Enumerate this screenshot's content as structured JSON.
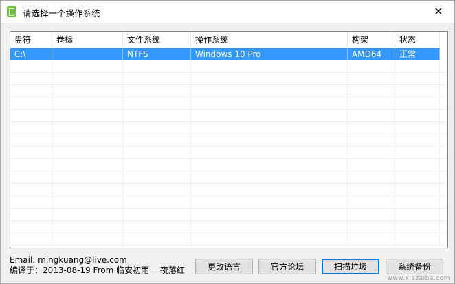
{
  "window": {
    "title": "请选择一个操作系统",
    "close_glyph": "✕"
  },
  "table": {
    "headers": [
      "盘符",
      "卷标",
      "文件系统",
      "操作系统",
      "构架",
      "状态"
    ],
    "rows": [
      [
        "C:\\",
        "",
        "NTFS",
        "Windows 10 Pro",
        "AMD64",
        "正常"
      ]
    ]
  },
  "footer": {
    "email_line": "Email:  mingkuang@live.com",
    "compile_line": "编译于：2013-08-19 From 临安初雨 一夜落红"
  },
  "buttons": {
    "language": "更改语言",
    "forum": "官方论坛",
    "clean": "扫描垃圾",
    "backup": "系统备份"
  },
  "watermark": "www.xiazaiba.com",
  "colors": {
    "selection": "#3399ff",
    "app_icon": "#6fbf3e",
    "default_button_border": "#0078d7"
  }
}
